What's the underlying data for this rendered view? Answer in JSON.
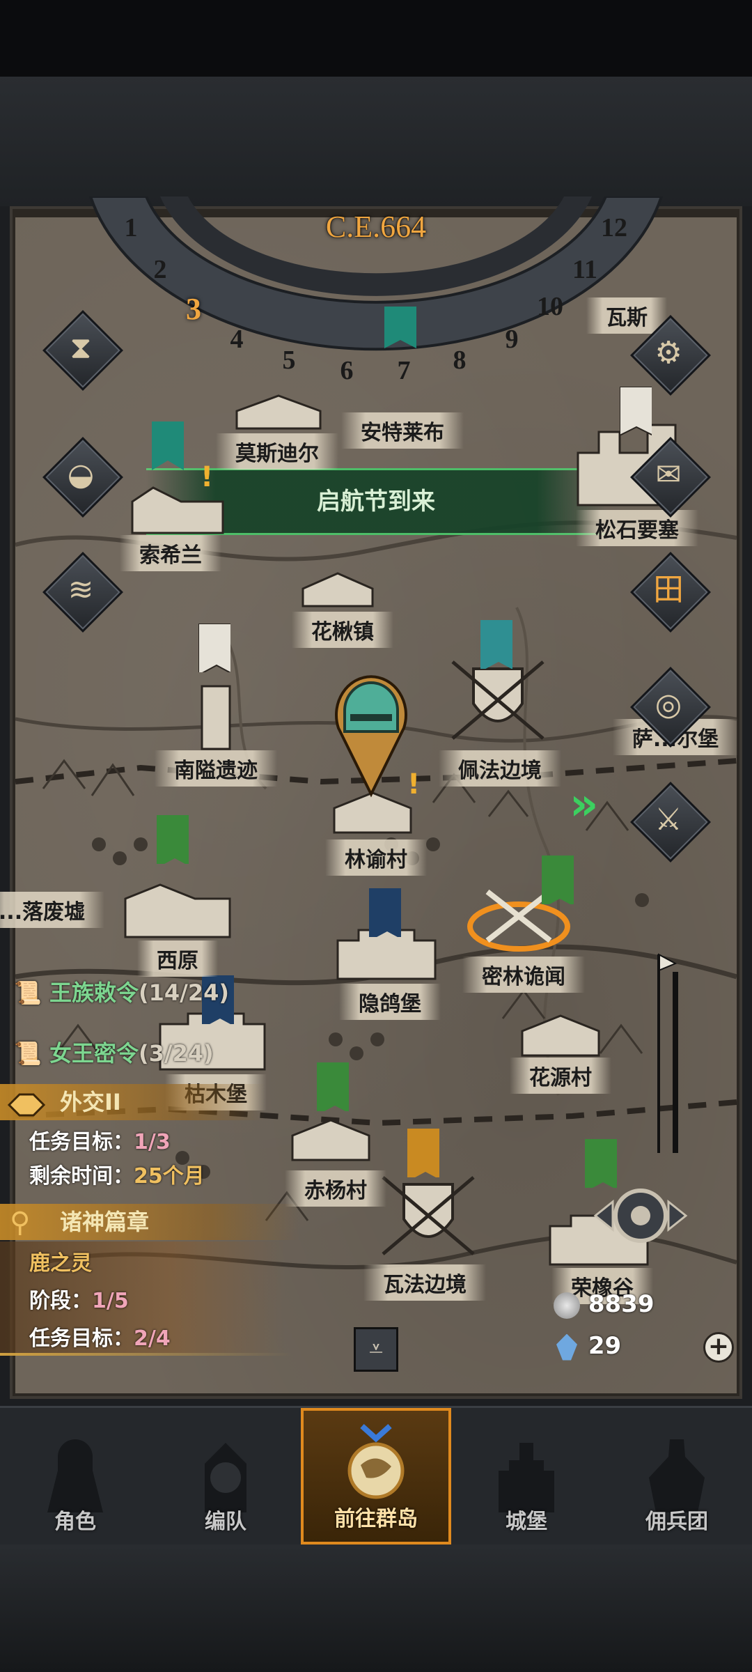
{
  "calendar": {
    "year": "C.E.664",
    "months": [
      "1",
      "2",
      "3",
      "4",
      "5",
      "6",
      "7",
      "8",
      "9",
      "10",
      "11",
      "12"
    ],
    "current_month": "3"
  },
  "festival_banner": "启航节到来",
  "locations": {
    "mosdiel": "莫斯迪尔",
    "antelebu": "安特莱布",
    "suoxilan": "索希兰",
    "songshi": "松石要塞",
    "wasi": "瓦斯",
    "huaqiu": "花楸镇",
    "nanyi": "南隘遗迹",
    "peifa": "佩法边境",
    "sa_fort": "萨...尔堡",
    "linyu": "林谕村",
    "ruins_left": "...落废墟",
    "xiyuan": "西原",
    "yinge": "隐鸽堡",
    "milin": "密林诡闻",
    "kumu": "枯木堡",
    "huayuan": "花源村",
    "chiyang": "赤杨村",
    "wafa": "瓦法边境",
    "rongxiang": "荣橡谷"
  },
  "quests": {
    "royal_edict": {
      "label": "王族敕令",
      "count": "(14/24)"
    },
    "queen_order": {
      "label": "女王密令",
      "count": "(3/24)"
    },
    "diplomacy": {
      "title": "外交II",
      "goal_label": "任务目标：",
      "goal_value": "1/3",
      "time_label": "剩余时间：",
      "time_value": "25个月"
    },
    "gods": {
      "title": "诸神篇章",
      "subtitle": "鹿之灵",
      "stage_label": "阶段：",
      "stage_value": "1/5",
      "goal_label": "任务目标：",
      "goal_value": "2/4"
    }
  },
  "resources": {
    "silver": "8839",
    "crystal": "29"
  },
  "side_buttons": [
    "hourglass-icon",
    "bag-icon",
    "scroll-icon",
    "gear-icon",
    "mail-icon",
    "window-icon",
    "coin-icon",
    "sword-icon"
  ],
  "nav": {
    "items": [
      "角色",
      "编队",
      "前往群岛",
      "城堡",
      "佣兵团"
    ],
    "active": "前往群岛"
  },
  "colors": {
    "accent_orange": "#f0a640",
    "edict_green": "#7dd690",
    "festival_green": "#164228",
    "progress_pink": "#f0a5b8"
  }
}
